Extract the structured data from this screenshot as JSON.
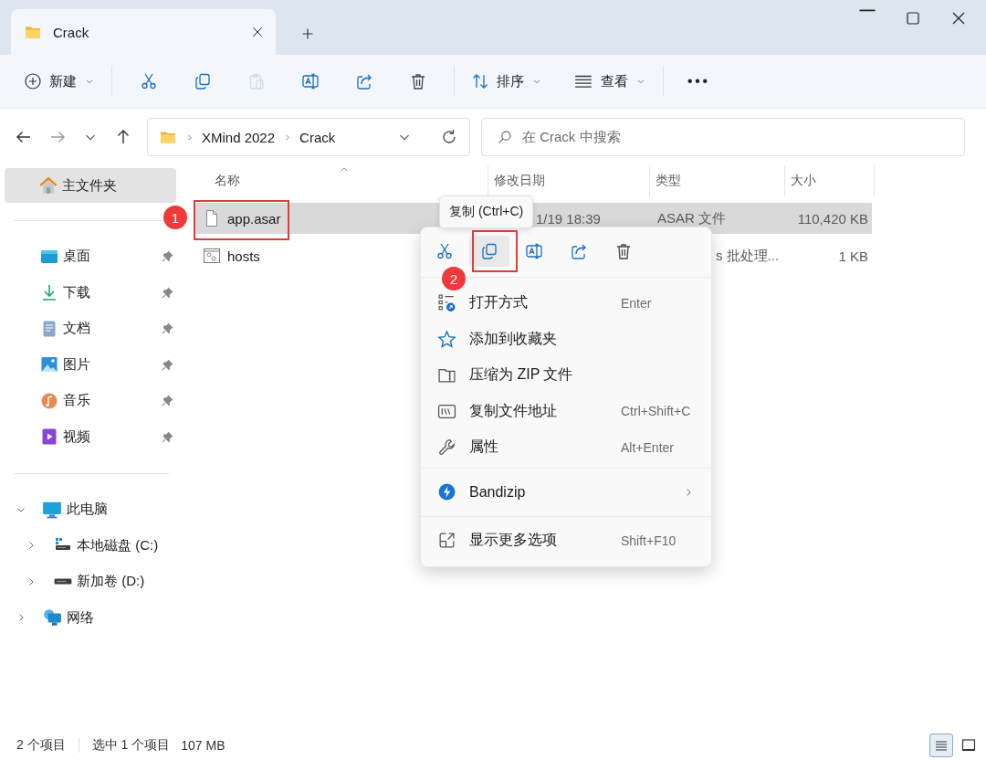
{
  "window": {
    "tab_title": "Crack"
  },
  "toolbar": {
    "new_label": "新建",
    "sort_label": "排序",
    "view_label": "查看",
    "actions": [
      {
        "kind": "cut",
        "disabled": false
      },
      {
        "kind": "copy",
        "disabled": false
      },
      {
        "kind": "paste",
        "disabled": true
      },
      {
        "kind": "rename",
        "disabled": false
      },
      {
        "kind": "share",
        "disabled": false
      },
      {
        "kind": "delete",
        "disabled": false
      }
    ]
  },
  "address": {
    "path": [
      "XMind 2022",
      "Crack"
    ]
  },
  "search": {
    "placeholder": "在 Crack 中搜索"
  },
  "sidebar": {
    "home": {
      "label": "主文件夹",
      "selected": true
    },
    "quick_access": [
      {
        "label": "桌面",
        "kind": "desktop",
        "pinned": true
      },
      {
        "label": "下载",
        "kind": "downloads",
        "pinned": true
      },
      {
        "label": "文档",
        "kind": "documents",
        "pinned": true
      },
      {
        "label": "图片",
        "kind": "pictures",
        "pinned": true
      },
      {
        "label": "音乐",
        "kind": "music",
        "pinned": true
      },
      {
        "label": "视频",
        "kind": "videos",
        "pinned": true
      }
    ],
    "this_pc": {
      "label": "此电脑",
      "expanded": true,
      "children": [
        {
          "label": "本地磁盘 (C:)",
          "kind": "system-drive",
          "expanded": false
        },
        {
          "label": "新加卷 (D:)",
          "kind": "drive",
          "expanded": false
        }
      ]
    },
    "network": {
      "label": "网络",
      "expanded": false
    }
  },
  "columns": [
    "名称",
    "修改日期",
    "类型",
    "大小"
  ],
  "files": [
    {
      "name": "app.asar",
      "kind": "file",
      "selected": true,
      "date": "1/19 18:39",
      "type": "ASAR 文件",
      "size": "110,420 KB"
    },
    {
      "name": "hosts",
      "kind": "system-file",
      "selected": false,
      "type": "s 批处理...",
      "size": "1 KB"
    }
  ],
  "context_menu": {
    "tooltip": "复制 (Ctrl+C)",
    "actions": [
      {
        "kind": "cut",
        "selected": false
      },
      {
        "kind": "copy",
        "selected": true
      },
      {
        "kind": "rename",
        "selected": false
      },
      {
        "kind": "share",
        "selected": false
      },
      {
        "kind": "delete",
        "selected": false
      }
    ],
    "items": [
      {
        "label": "打开方式",
        "kind": "open-with",
        "shortcut": "Enter",
        "separator_before": false,
        "submenu": false
      },
      {
        "label": "添加到收藏夹",
        "kind": "favorite",
        "separator_before": false,
        "submenu": false
      },
      {
        "label": "压缩为 ZIP 文件",
        "kind": "zip",
        "separator_before": false,
        "submenu": false
      },
      {
        "label": "复制文件地址",
        "kind": "copy-path",
        "shortcut": "Ctrl+Shift+C",
        "separator_before": false,
        "submenu": false
      },
      {
        "label": "属性",
        "kind": "properties",
        "shortcut": "Alt+Enter",
        "separator_before": false,
        "submenu": false
      },
      {
        "label": "Bandizip",
        "kind": "bandizip",
        "separator_before": true,
        "submenu": true
      },
      {
        "label": "显示更多选项",
        "kind": "more-options",
        "shortcut": "Shift+F10",
        "separator_before": true,
        "submenu": false
      }
    ]
  },
  "annotations": [
    {
      "label": "1"
    },
    {
      "label": "2"
    }
  ],
  "status_bar": {
    "count": "2 个项目",
    "selection": "选中 1 个项目",
    "selection_size": "107 MB",
    "views": [
      {
        "kind": "details",
        "selected": true
      },
      {
        "kind": "tiles",
        "selected": false
      }
    ]
  }
}
